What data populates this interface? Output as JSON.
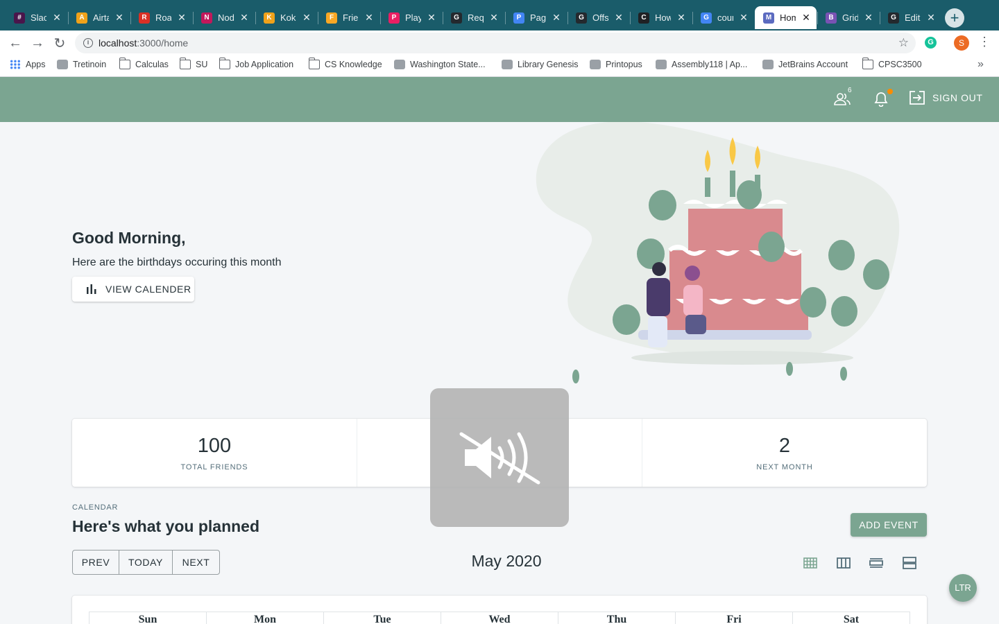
{
  "browser": {
    "tabs": [
      {
        "title": "Slack",
        "favicon": "slack-icon",
        "color": "#4a154b",
        "glyph": "#"
      },
      {
        "title": "Airtable",
        "favicon": "airtable-icon",
        "color": "#f0a21a",
        "glyph": "A"
      },
      {
        "title": "Roadmap",
        "favicon": "car-icon",
        "color": "#d93025",
        "glyph": "R"
      },
      {
        "title": "Node",
        "favicon": "node-icon",
        "color": "#c2185b",
        "glyph": "N"
      },
      {
        "title": "Kokaden",
        "favicon": "koka-icon",
        "color": "#f0a21a",
        "glyph": "K"
      },
      {
        "title": "Friends",
        "favicon": "firebase-icon",
        "color": "#f9a825",
        "glyph": "F"
      },
      {
        "title": "Playground",
        "favicon": "play-icon",
        "color": "#e91e63",
        "glyph": "P"
      },
      {
        "title": "Requests",
        "favicon": "github-icon",
        "color": "#24292e",
        "glyph": "G"
      },
      {
        "title": "Pagination",
        "favicon": "pagination-icon",
        "color": "#4285f4",
        "glyph": "P"
      },
      {
        "title": "Offset",
        "favicon": "github-icon",
        "color": "#24292e",
        "glyph": "G"
      },
      {
        "title": "How",
        "favicon": "c-icon",
        "color": "#202124",
        "glyph": "C"
      },
      {
        "title": "count",
        "favicon": "google-icon",
        "color": "#4285f4",
        "glyph": "G"
      },
      {
        "title": "Home",
        "favicon": "material-kit-icon",
        "color": "#5c6bc0",
        "glyph": "M"
      },
      {
        "title": "Grid",
        "favicon": "bootstrap-icon",
        "color": "#7952b3",
        "glyph": "B"
      },
      {
        "title": "Editing",
        "favicon": "github-icon",
        "color": "#24292e",
        "glyph": "G"
      }
    ],
    "active_tab": 12,
    "url_host": "localhost",
    "url_path": ":3000/home",
    "profile_initial": "S",
    "grammarly_initial": "G",
    "bookmarks": [
      {
        "label": "Apps",
        "icon": "apps-grid-icon"
      },
      {
        "label": "Tretinoin",
        "icon": "mask-icon"
      },
      {
        "label": "Calculas",
        "icon": "folder-icon"
      },
      {
        "label": "SU",
        "icon": "folder-icon"
      },
      {
        "label": "Job Application",
        "icon": "folder-icon"
      },
      {
        "label": "CS Knowledge",
        "icon": "folder-icon"
      },
      {
        "label": "Washington State...",
        "icon": "document-icon"
      },
      {
        "label": "Library Genesis",
        "icon": "library-icon"
      },
      {
        "label": "Printopus",
        "icon": "octopus-icon"
      },
      {
        "label": "Assembly118 | Ap...",
        "icon": "chrome-icon"
      },
      {
        "label": "JetBrains Account",
        "icon": "jetbrains-icon"
      },
      {
        "label": "CPSC3500",
        "icon": "folder-icon"
      }
    ]
  },
  "header": {
    "friends_count": "6",
    "sign_out_label": "SIGN OUT"
  },
  "hero": {
    "greeting": "Good Morning,",
    "subtitle": "Here are the birthdays occuring this month",
    "view_calendar_label": "VIEW CALENDER"
  },
  "stats": [
    {
      "value": "100",
      "label": "TOTAL FRIENDS"
    },
    {
      "value": "",
      "label": ""
    },
    {
      "value": "2",
      "label": "NEXT MONTH"
    }
  ],
  "calendar": {
    "overline": "CALENDAR",
    "title": "Here's what you planned",
    "add_event_label": "ADD EVENT",
    "prev_label": "PREV",
    "today_label": "TODAY",
    "next_label": "NEXT",
    "month": "May 2020",
    "days": [
      "Sun",
      "Mon",
      "Tue",
      "Wed",
      "Thu",
      "Fri",
      "Sat"
    ]
  },
  "direction_toggle": "LTR",
  "colors": {
    "primary": "#7ba591",
    "background": "#f4f6f8",
    "tab_bar": "#1a5c6a",
    "notification_dot": "#fb8c00"
  }
}
